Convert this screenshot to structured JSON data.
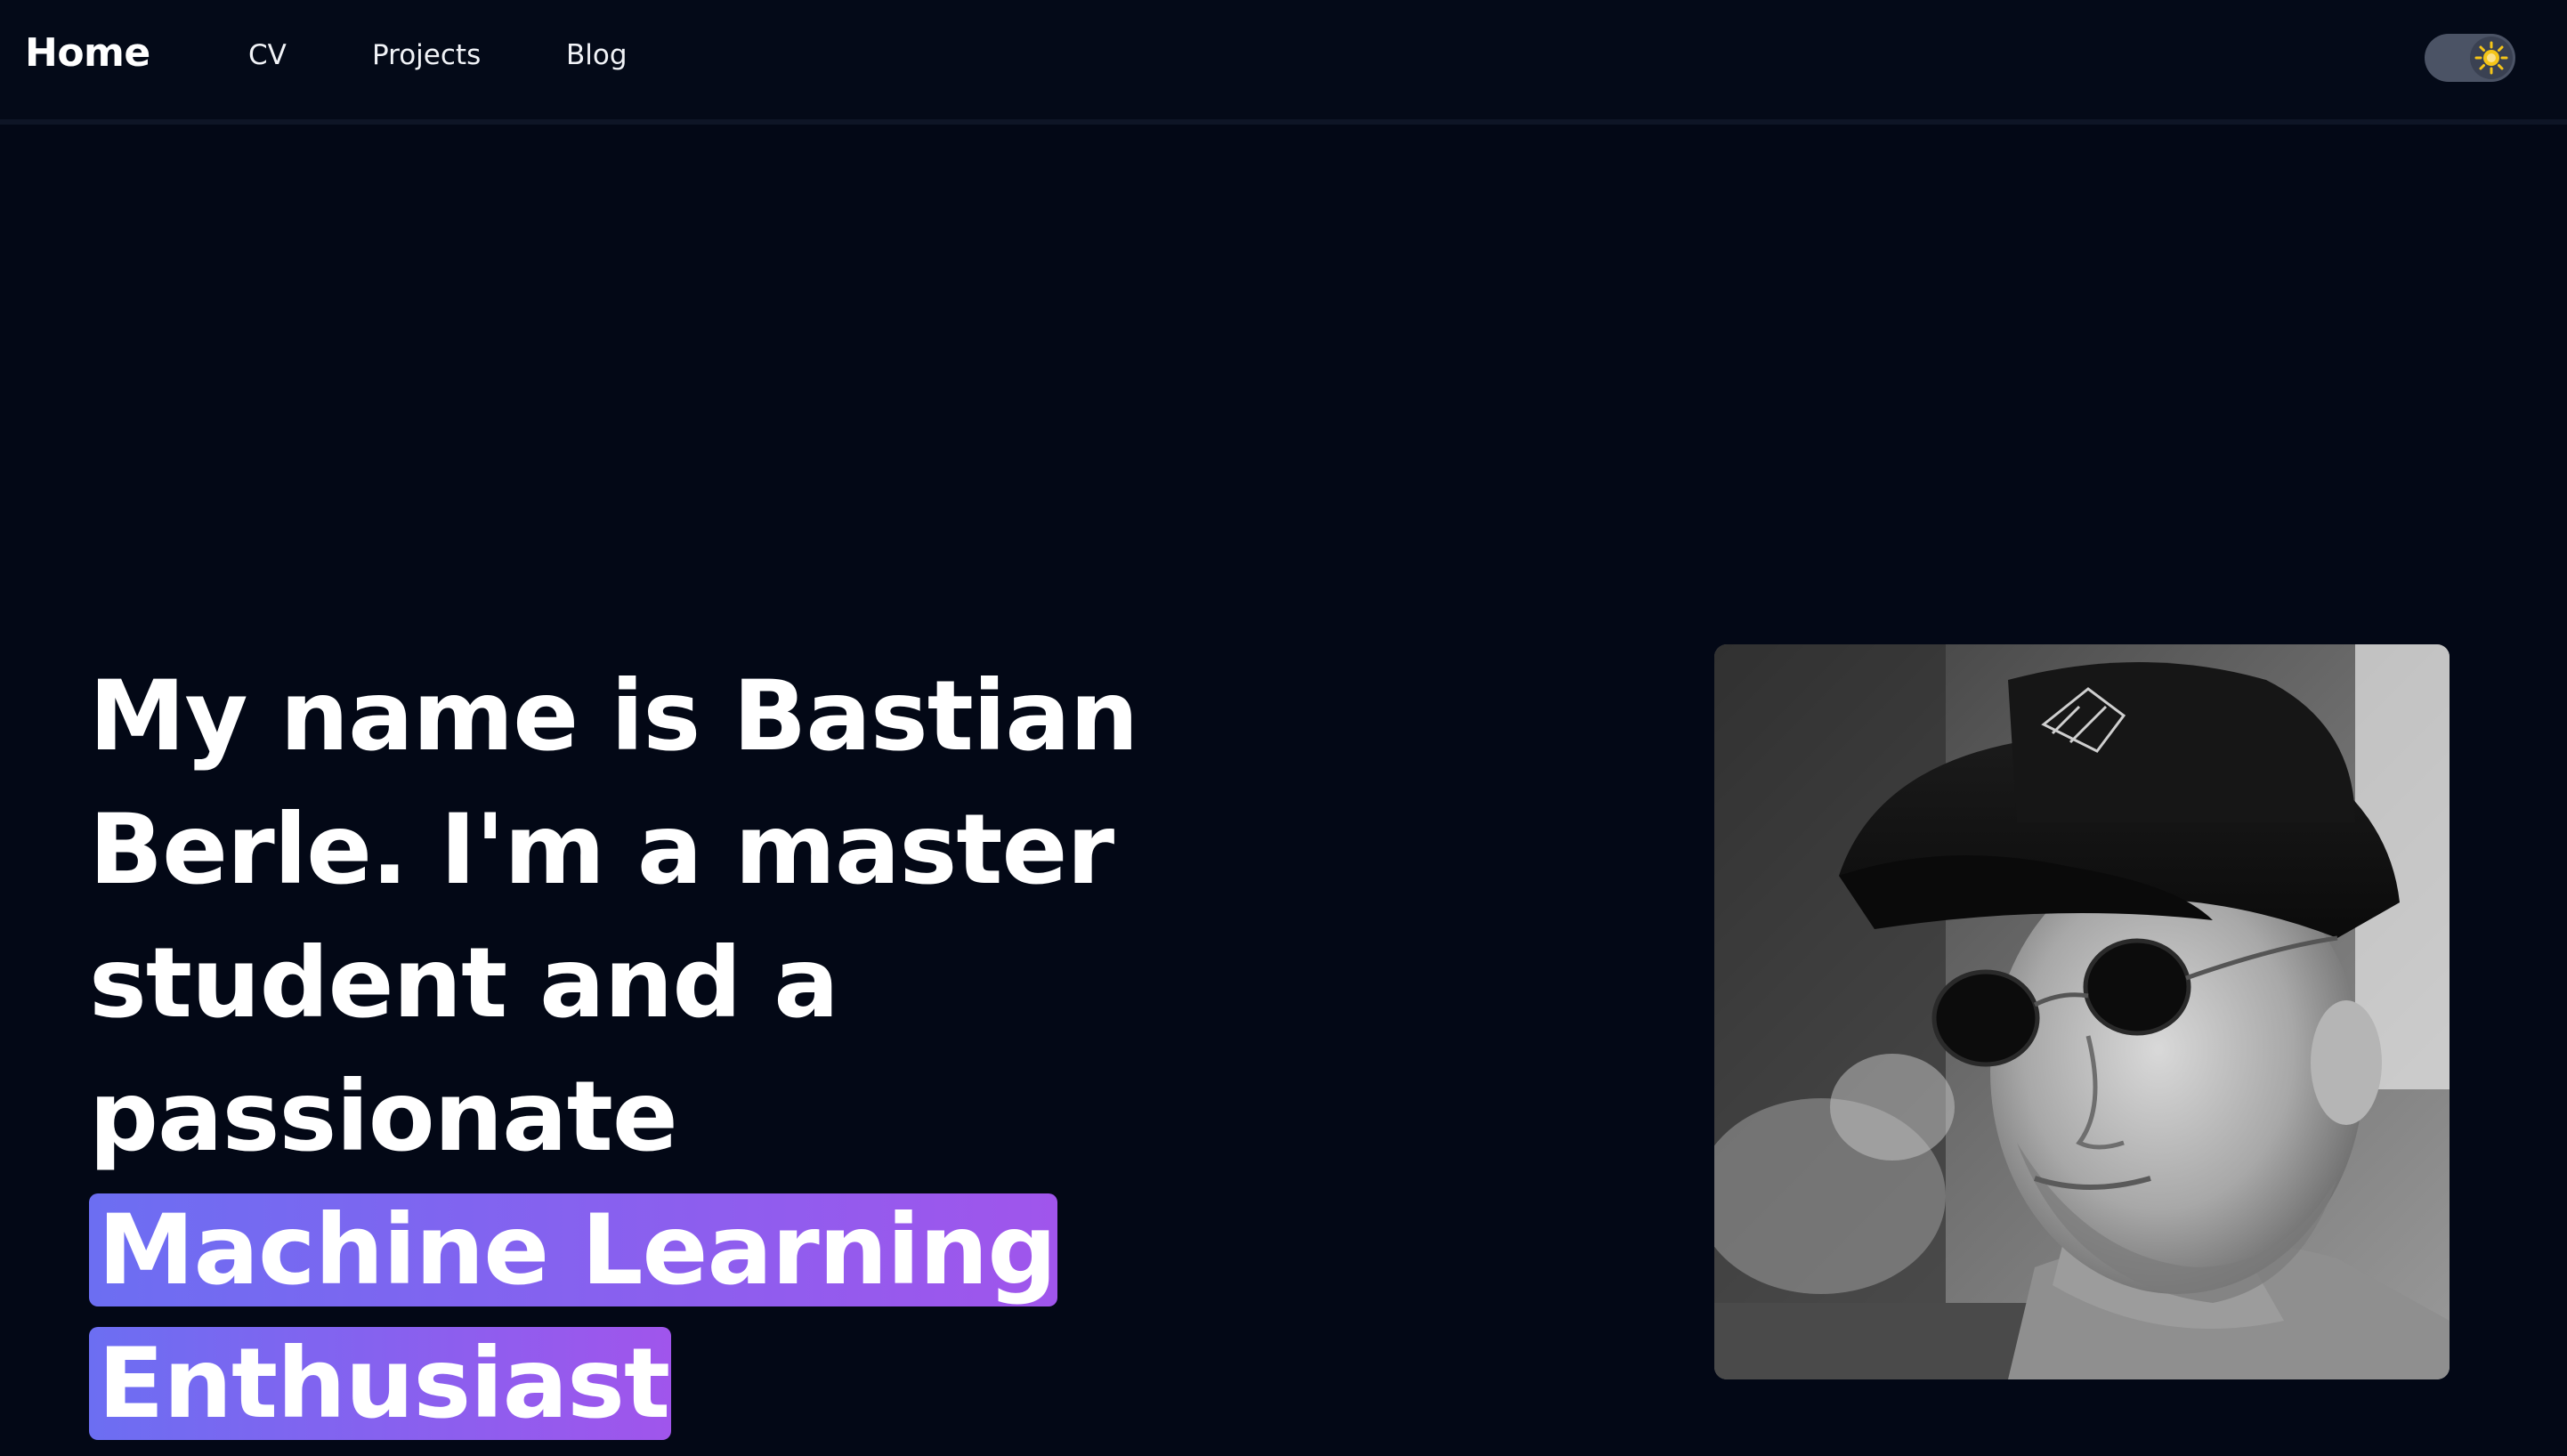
{
  "nav": {
    "home": "Home",
    "links": [
      "CV",
      "Projects",
      "Blog"
    ]
  },
  "theme_toggle": {
    "icon": "sun-icon",
    "state": "dark",
    "knob_color": "#f5c518"
  },
  "hero": {
    "text_before": "My name is Bastian Berle. I'm a master student and a passionate ",
    "highlight": "Machine Learning Enthusiast",
    "highlight_gradient": [
      "#6c6ef2",
      "#a055ec"
    ]
  },
  "portrait": {
    "description": "black-and-white photo"
  },
  "colors": {
    "background": "#030816",
    "navbar": "#040a18",
    "text": "#ffffff"
  }
}
